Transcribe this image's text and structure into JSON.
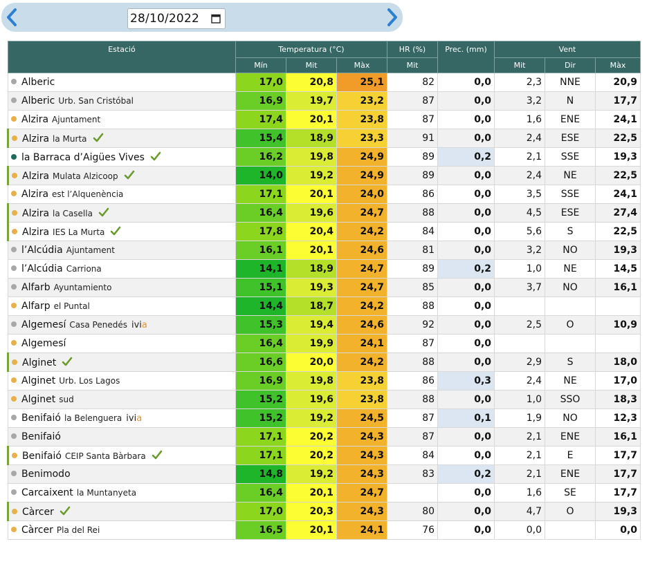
{
  "datebar": {
    "date": "28/10/2022",
    "prev_icon": "chevron-left-icon",
    "next_icon": "chevron-right-icon",
    "calendar_icon": "calendar-icon"
  },
  "colors": {
    "header_bg": "#376764",
    "dot_orange": "#e8b04a",
    "dot_gray": "#a8a8a8",
    "dot_teal": "#1f6b5e",
    "check_green": "#6a9a2a",
    "precip_bg": "#dce6f3",
    "temp_scale": {
      "12.5-13.9": "#16c760",
      "14-14.9": "#1fb52b",
      "15-15.9": "#3fc22a",
      "16-16.9": "#6bce26",
      "17-17.9": "#8cd61e",
      "18-18.9": "#b4e02a",
      "19-19.9": "#dbec34",
      "20-20.9": "#fdfd33",
      "21-21.9": "#fde846",
      "22-22.9": "#fbd34c",
      "23-23.9": "#f6d134",
      "24-24.9": "#f3b22c",
      "25-25.9": "#f19b28"
    }
  },
  "table": {
    "headers": {
      "station": "Estació",
      "temperature": "Temperatura (°C)",
      "hr": "HR (%)",
      "prec": "Prec. (mm)",
      "wind": "Vent"
    },
    "subheaders": {
      "t_min": "Mín",
      "t_mit": "Mit",
      "t_max": "Màx",
      "hr_mit": "Mit",
      "w_mit": "Mit",
      "w_dir": "Dir",
      "w_max": "Màx"
    },
    "rows": [
      {
        "town": "Alberic",
        "sub": "",
        "dot": "gray",
        "mark": false,
        "check": false,
        "ivia": false,
        "min": "17,0",
        "mit": "20,8",
        "max": "25,1",
        "hr": "82",
        "prec": "0,0",
        "w_mit": "2,3",
        "dir": "NNE",
        "w_max": "20,9"
      },
      {
        "town": "Alberic",
        "sub": "Urb. San Cristóbal",
        "dot": "gray",
        "mark": false,
        "check": false,
        "ivia": false,
        "min": "16,9",
        "mit": "19,7",
        "max": "23,2",
        "hr": "87",
        "prec": "0,0",
        "w_mit": "3,2",
        "dir": "N",
        "w_max": "17,7"
      },
      {
        "town": "Alzira",
        "sub": "Ajuntament",
        "dot": "orange",
        "mark": false,
        "check": false,
        "ivia": false,
        "min": "17,4",
        "mit": "20,1",
        "max": "23,8",
        "hr": "87",
        "prec": "0,0",
        "w_mit": "1,6",
        "dir": "ENE",
        "w_max": "24,1"
      },
      {
        "town": "Alzira",
        "sub": "la Murta",
        "dot": "orange",
        "mark": true,
        "check": true,
        "ivia": false,
        "min": "15,4",
        "mit": "18,9",
        "max": "23,3",
        "hr": "91",
        "prec": "0,0",
        "w_mit": "2,4",
        "dir": "ESE",
        "w_max": "22,5"
      },
      {
        "town": "la Barraca d’Aigües Vives",
        "sub": "",
        "dot": "teal",
        "mark": false,
        "check": true,
        "ivia": false,
        "min": "16,2",
        "mit": "19,8",
        "max": "24,9",
        "hr": "89",
        "prec": "0,2",
        "w_mit": "2,1",
        "dir": "SSE",
        "w_max": "19,3"
      },
      {
        "town": "Alzira",
        "sub": "Mulata Alzicoop",
        "dot": "orange",
        "mark": true,
        "check": true,
        "ivia": false,
        "min": "14,0",
        "mit": "19,2",
        "max": "24,9",
        "hr": "89",
        "prec": "0,0",
        "w_mit": "2,4",
        "dir": "NE",
        "w_max": "22,5"
      },
      {
        "town": "Alzira",
        "sub": "est l’Alquenència",
        "dot": "orange",
        "mark": false,
        "check": false,
        "ivia": false,
        "min": "17,1",
        "mit": "20,1",
        "max": "24,0",
        "hr": "86",
        "prec": "0,0",
        "w_mit": "3,5",
        "dir": "SSE",
        "w_max": "24,1"
      },
      {
        "town": "Alzira",
        "sub": "la Casella",
        "dot": "orange",
        "mark": true,
        "check": true,
        "ivia": false,
        "min": "16,4",
        "mit": "19,6",
        "max": "24,7",
        "hr": "88",
        "prec": "0,0",
        "w_mit": "4,5",
        "dir": "ESE",
        "w_max": "27,4"
      },
      {
        "town": "Alzira",
        "sub": "IES La Murta",
        "dot": "orange",
        "mark": true,
        "check": true,
        "ivia": false,
        "min": "17,8",
        "mit": "20,4",
        "max": "24,2",
        "hr": "84",
        "prec": "0,0",
        "w_mit": "5,6",
        "dir": "S",
        "w_max": "22,5"
      },
      {
        "town": "l’Alcúdia",
        "sub": "Ajuntament",
        "dot": "gray",
        "mark": false,
        "check": false,
        "ivia": false,
        "min": "16,1",
        "mit": "20,1",
        "max": "24,6",
        "hr": "81",
        "prec": "0,0",
        "w_mit": "3,2",
        "dir": "NO",
        "w_max": "19,3"
      },
      {
        "town": "l’Alcúdia",
        "sub": "Carriona",
        "dot": "gray",
        "mark": false,
        "check": false,
        "ivia": false,
        "min": "14,1",
        "mit": "18,9",
        "max": "24,7",
        "hr": "89",
        "prec": "0,2",
        "w_mit": "1,0",
        "dir": "NE",
        "w_max": "14,5"
      },
      {
        "town": "Alfarb",
        "sub": "Ayuntamiento",
        "dot": "gray",
        "mark": false,
        "check": false,
        "ivia": false,
        "min": "15,1",
        "mit": "19,3",
        "max": "24,7",
        "hr": "85",
        "prec": "0,0",
        "w_mit": "3,7",
        "dir": "NO",
        "w_max": "16,1"
      },
      {
        "town": "Alfarp",
        "sub": "el Puntal",
        "dot": "orange",
        "mark": false,
        "check": false,
        "ivia": false,
        "min": "14,4",
        "mit": "18,7",
        "max": "24,2",
        "hr": "88",
        "prec": "0,0",
        "w_mit": "",
        "dir": "",
        "w_max": ""
      },
      {
        "town": "Algemesí",
        "sub": "Casa Penedés",
        "dot": "gray",
        "mark": false,
        "check": false,
        "ivia": true,
        "min": "15,3",
        "mit": "19,4",
        "max": "24,6",
        "hr": "92",
        "prec": "0,0",
        "w_mit": "2,5",
        "dir": "O",
        "w_max": "10,9"
      },
      {
        "town": "Algemesí",
        "sub": "",
        "dot": "orange",
        "mark": false,
        "check": false,
        "ivia": false,
        "min": "16,4",
        "mit": "19,9",
        "max": "24,1",
        "hr": "87",
        "prec": "0,0",
        "w_mit": "",
        "dir": "",
        "w_max": ""
      },
      {
        "town": "Alginet",
        "sub": "",
        "dot": "orange",
        "mark": true,
        "check": true,
        "ivia": false,
        "min": "16,6",
        "mit": "20,0",
        "max": "24,2",
        "hr": "88",
        "prec": "0,0",
        "w_mit": "2,9",
        "dir": "S",
        "w_max": "18,0"
      },
      {
        "town": "Alginet",
        "sub": "Urb. Los Lagos",
        "dot": "orange",
        "mark": false,
        "check": false,
        "ivia": false,
        "min": "16,9",
        "mit": "19,8",
        "max": "23,8",
        "hr": "86",
        "prec": "0,3",
        "w_mit": "2,4",
        "dir": "NE",
        "w_max": "17,0"
      },
      {
        "town": "Alginet",
        "sub": "sud",
        "dot": "orange",
        "mark": false,
        "check": false,
        "ivia": false,
        "min": "15,2",
        "mit": "19,6",
        "max": "23,8",
        "hr": "88",
        "prec": "0,0",
        "w_mit": "1,0",
        "dir": "SSO",
        "w_max": "18,3"
      },
      {
        "town": "Benifaió",
        "sub": "la Belenguera",
        "dot": "gray",
        "mark": false,
        "check": false,
        "ivia": true,
        "min": "15,2",
        "mit": "19,2",
        "max": "24,5",
        "hr": "87",
        "prec": "0,1",
        "w_mit": "1,9",
        "dir": "NO",
        "w_max": "12,3"
      },
      {
        "town": "Benifaió",
        "sub": "",
        "dot": "gray",
        "mark": false,
        "check": false,
        "ivia": false,
        "min": "17,1",
        "mit": "20,2",
        "max": "24,3",
        "hr": "87",
        "prec": "0,0",
        "w_mit": "2,1",
        "dir": "ENE",
        "w_max": "16,1"
      },
      {
        "town": "Benifaió",
        "sub": "CEIP Santa Bàrbara",
        "dot": "orange",
        "mark": true,
        "check": true,
        "ivia": false,
        "min": "17,1",
        "mit": "20,2",
        "max": "24,3",
        "hr": "84",
        "prec": "0,0",
        "w_mit": "2,1",
        "dir": "E",
        "w_max": "17,7"
      },
      {
        "town": "Benimodo",
        "sub": "",
        "dot": "gray",
        "mark": false,
        "check": false,
        "ivia": false,
        "min": "14,8",
        "mit": "19,2",
        "max": "24,3",
        "hr": "83",
        "prec": "0,2",
        "w_mit": "2,1",
        "dir": "ENE",
        "w_max": "17,7"
      },
      {
        "town": "Carcaixent",
        "sub": "la Muntanyeta",
        "dot": "gray",
        "mark": false,
        "check": false,
        "ivia": false,
        "min": "16,4",
        "mit": "20,1",
        "max": "24,7",
        "hr": "",
        "prec": "0,0",
        "w_mit": "1,6",
        "dir": "SE",
        "w_max": "17,7"
      },
      {
        "town": "Càrcer",
        "sub": "",
        "dot": "orange",
        "mark": true,
        "check": true,
        "ivia": false,
        "min": "17,0",
        "mit": "20,3",
        "max": "24,3",
        "hr": "80",
        "prec": "0,0",
        "w_mit": "4,7",
        "dir": "O",
        "w_max": "19,3"
      },
      {
        "town": "Càrcer",
        "sub": "Pla del Rei",
        "dot": "orange",
        "mark": false,
        "check": false,
        "ivia": false,
        "min": "16,5",
        "mit": "20,1",
        "max": "24,1",
        "hr": "76",
        "prec": "0,0",
        "w_mit": "0,0",
        "dir": "",
        "w_max": "0,0"
      }
    ],
    "ivia_label_i": "ivi",
    "ivia_label_a": "a"
  }
}
